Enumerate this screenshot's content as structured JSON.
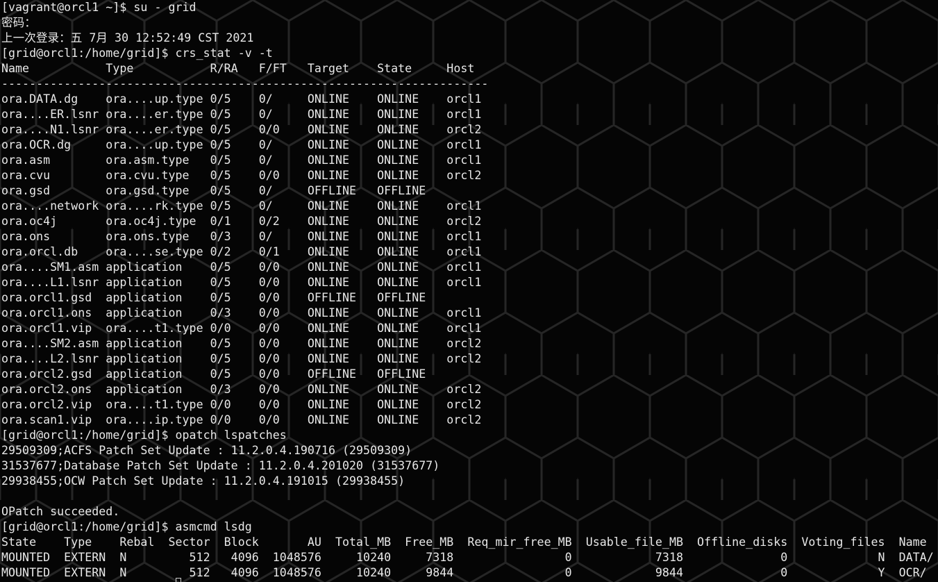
{
  "terminal": {
    "lines": [
      "[vagrant@orcl1 ~]$ su - grid",
      "密码：",
      "上一次登录：五 7月 30 12:52:49 CST 2021",
      "[grid@orcl1:/home/grid]$ crs_stat -v -t",
      "Name           Type           R/RA   F/FT   Target    State     Host",
      "----------------------------------------------------------------------",
      "ora.DATA.dg    ora....up.type 0/5    0/     ONLINE    ONLINE    orcl1",
      "ora....ER.lsnr ora....er.type 0/5    0/     ONLINE    ONLINE    orcl1",
      "ora....N1.lsnr ora....er.type 0/5    0/0    ONLINE    ONLINE    orcl2",
      "ora.OCR.dg     ora....up.type 0/5    0/     ONLINE    ONLINE    orcl1",
      "ora.asm        ora.asm.type   0/5    0/     ONLINE    ONLINE    orcl1",
      "ora.cvu        ora.cvu.type   0/5    0/0    ONLINE    ONLINE    orcl2",
      "ora.gsd        ora.gsd.type   0/5    0/     OFFLINE   OFFLINE",
      "ora....network ora....rk.type 0/5    0/     ONLINE    ONLINE    orcl1",
      "ora.oc4j       ora.oc4j.type  0/1    0/2    ONLINE    ONLINE    orcl2",
      "ora.ons        ora.ons.type   0/3    0/     ONLINE    ONLINE    orcl1",
      "ora.orcl.db    ora....se.type 0/2    0/1    ONLINE    ONLINE    orcl1",
      "ora....SM1.asm application    0/5    0/0    ONLINE    ONLINE    orcl1",
      "ora....L1.lsnr application    0/5    0/0    ONLINE    ONLINE    orcl1",
      "ora.orcl1.gsd  application    0/5    0/0    OFFLINE   OFFLINE",
      "ora.orcl1.ons  application    0/3    0/0    ONLINE    ONLINE    orcl1",
      "ora.orcl1.vip  ora....t1.type 0/0    0/0    ONLINE    ONLINE    orcl1",
      "ora....SM2.asm application    0/5    0/0    ONLINE    ONLINE    orcl2",
      "ora....L2.lsnr application    0/5    0/0    ONLINE    ONLINE    orcl2",
      "ora.orcl2.gsd  application    0/5    0/0    OFFLINE   OFFLINE",
      "ora.orcl2.ons  application    0/3    0/0    ONLINE    ONLINE    orcl2",
      "ora.orcl2.vip  ora....t1.type 0/0    0/0    ONLINE    ONLINE    orcl2",
      "ora.scan1.vip  ora....ip.type 0/0    0/0    ONLINE    ONLINE    orcl2",
      "[grid@orcl1:/home/grid]$ opatch lspatches",
      "29509309;ACFS Patch Set Update : 11.2.0.4.190716 (29509309)",
      "31537677;Database Patch Set Update : 11.2.0.4.201020 (31537677)",
      "29938455;OCW Patch Set Update : 11.2.0.4.191015 (29938455)",
      "",
      "OPatch succeeded.",
      "[grid@orcl1:/home/grid]$ asmcmd lsdg",
      "State    Type    Rebal  Sector  Block       AU  Total_MB  Free_MB  Req_mir_free_MB  Usable_file_MB  Offline_disks  Voting_files  Name",
      "MOUNTED  EXTERN  N         512   4096  1048576     10240     7318                0            7318              0             N  DATA/",
      "MOUNTED  EXTERN  N         512   4096  1048576     10240     9844                0            9844              0             Y  OCR/"
    ]
  }
}
